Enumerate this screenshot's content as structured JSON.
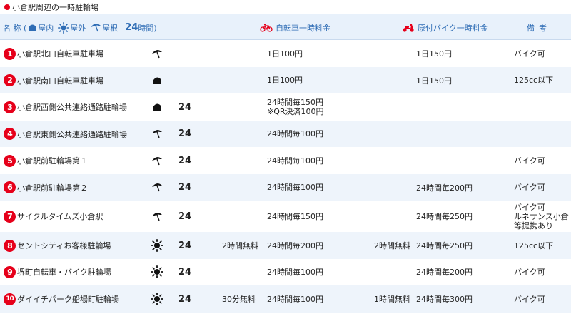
{
  "title": "小倉駅周辺の一時駐輪場",
  "header": {
    "legend_prefix": "名 称 (",
    "legend_indoor": "屋内",
    "legend_outdoor": "屋外",
    "legend_roof": "屋根",
    "legend_24": "24",
    "legend_suffix": "時間)",
    "bike_fee": "自転車一時料金",
    "moto_fee": "原付バイク一時料金",
    "notes": "備考"
  },
  "colors": {
    "accent_red": "#e6001a",
    "header_blue": "#2f6db5",
    "header_bg": "#e8f1fb",
    "row_alt_bg": "#eef4fb"
  },
  "rows": [
    {
      "num": "1",
      "name": "小倉駅北口自転車駐車場",
      "type": "roof",
      "h24": "",
      "bike_free": "",
      "bike_fee": [
        "1日100円"
      ],
      "moto_free": "",
      "moto_fee": "1日150円",
      "note": [
        "バイク可"
      ]
    },
    {
      "num": "2",
      "name": "小倉駅南口自転車駐車場",
      "type": "indoor",
      "h24": "",
      "bike_free": "",
      "bike_fee": [
        "1日100円"
      ],
      "moto_free": "",
      "moto_fee": "1日150円",
      "note": [
        "125cc以下"
      ]
    },
    {
      "num": "3",
      "name": "小倉駅西側公共連絡通路駐輪場",
      "type": "indoor",
      "h24": "24",
      "bike_free": "",
      "bike_fee": [
        "24時間毎150円",
        "※QR決済100円"
      ],
      "moto_free": "",
      "moto_fee": "",
      "note": []
    },
    {
      "num": "4",
      "name": "小倉駅東側公共連絡通路駐輪場",
      "type": "roof",
      "h24": "24",
      "bike_free": "",
      "bike_fee": [
        "24時間毎100円"
      ],
      "moto_free": "",
      "moto_fee": "",
      "note": []
    },
    {
      "num": "5",
      "name": "小倉駅前駐輪場第１",
      "type": "roof",
      "h24": "24",
      "bike_free": "",
      "bike_fee": [
        "24時間毎100円"
      ],
      "moto_free": "",
      "moto_fee": "",
      "note": [
        "バイク可"
      ]
    },
    {
      "num": "6",
      "name": "小倉駅前駐輪場第２",
      "type": "roof",
      "h24": "24",
      "bike_free": "",
      "bike_fee": [
        "24時間毎100円"
      ],
      "moto_free": "",
      "moto_fee": "24時間毎200円",
      "note": [
        "バイク可"
      ]
    },
    {
      "num": "7",
      "name": "サイクルタイムズ小倉駅",
      "type": "roof",
      "h24": "24",
      "bike_free": "",
      "bike_fee": [
        "24時間毎150円"
      ],
      "moto_free": "",
      "moto_fee": "24時間毎250円",
      "note": [
        "バイク可",
        "ルネサンス小倉",
        "等提携あり"
      ]
    },
    {
      "num": "8",
      "name": "セントシティお客様駐輪場",
      "type": "outdoor",
      "h24": "24",
      "bike_free": "2時間無料",
      "bike_fee": [
        "24時間毎200円"
      ],
      "moto_free": "2時間無料",
      "moto_fee": "24時間毎250円",
      "note": [
        "125cc以下"
      ]
    },
    {
      "num": "9",
      "name": "堺町自転車・バイク駐輪場",
      "type": "outdoor",
      "h24": "24",
      "bike_free": "",
      "bike_fee": [
        "24時間毎100円"
      ],
      "moto_free": "",
      "moto_fee": "24時間毎200円",
      "note": [
        "バイク可"
      ]
    },
    {
      "num": "10",
      "name": "ダイイチパーク船場町駐輪場",
      "type": "outdoor",
      "h24": "24",
      "bike_free": "30分無料",
      "bike_fee": [
        "24時間毎100円"
      ],
      "moto_free": "1時間無料",
      "moto_fee": "24時間毎300円",
      "note": [
        "バイク可"
      ]
    }
  ]
}
